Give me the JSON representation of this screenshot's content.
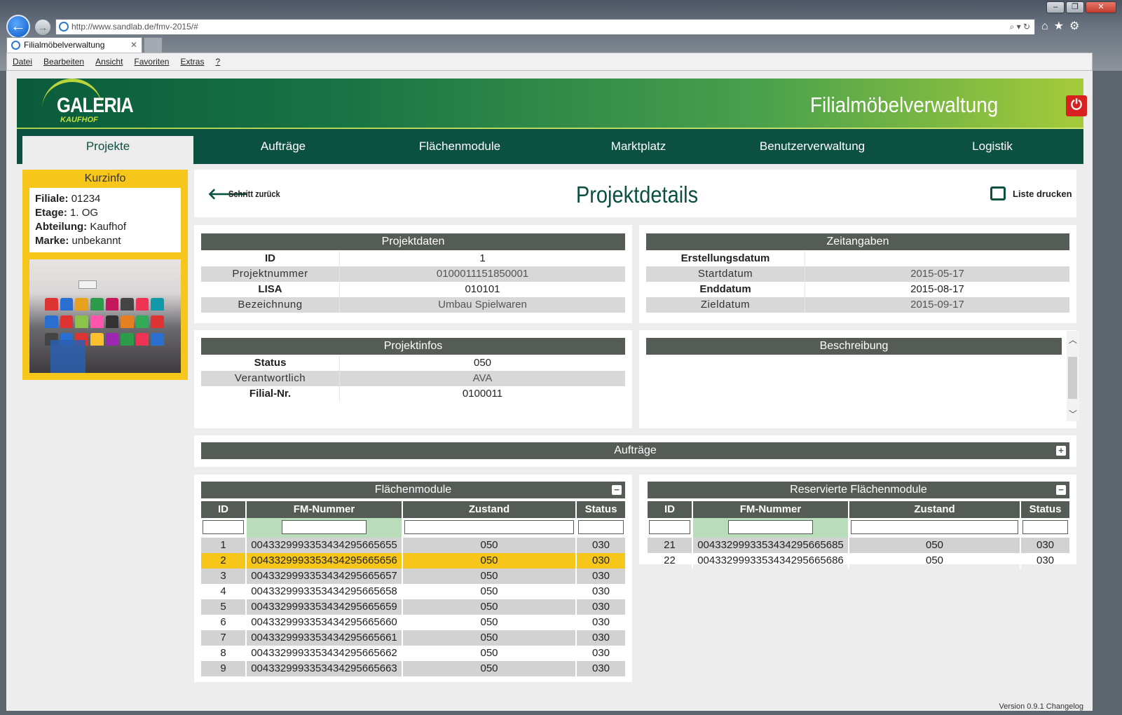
{
  "browser": {
    "url": "http://www.sandlab.de/fmv-2015/#",
    "tab_title": "Filialmöbelverwaltung",
    "menu": [
      "Datei",
      "Bearbeiten",
      "Ansicht",
      "Favoriten",
      "Extras",
      "?"
    ]
  },
  "header": {
    "logo_main": "GALERIA",
    "logo_sub": "KAUFHOF",
    "app_title": "Filialmöbelverwaltung"
  },
  "nav": [
    "Projekte",
    "Aufträge",
    "Flächenmodule",
    "Marktplatz",
    "Benutzerverwaltung",
    "Logistik"
  ],
  "kurzinfo": {
    "title": "Kurzinfo",
    "filiale_label": "Filiale:",
    "filiale": "01234",
    "etage_label": "Etage:",
    "etage": "1. OG",
    "abteilung_label": "Abteilung:",
    "abteilung": "Kaufhof",
    "marke_label": "Marke:",
    "marke": "unbekannt"
  },
  "toolbar": {
    "back_label": "Schritt zurück",
    "page_title": "Projektdetails",
    "print_label": "Liste drucken"
  },
  "projektdaten": {
    "title": "Projektdaten",
    "rows": [
      {
        "k": "ID",
        "v": "1"
      },
      {
        "k": "Projektnummer",
        "v": "0100011151850001"
      },
      {
        "k": "LISA",
        "v": "010101"
      },
      {
        "k": "Bezeichnung",
        "v": "Umbau Spielwaren"
      }
    ]
  },
  "zeitangaben": {
    "title": "Zeitangaben",
    "rows": [
      {
        "k": "Erstellungsdatum",
        "v": ""
      },
      {
        "k": "Startdatum",
        "v": "2015-05-17"
      },
      {
        "k": "Enddatum",
        "v": "2015-08-17"
      },
      {
        "k": "Zieldatum",
        "v": "2015-09-17"
      }
    ]
  },
  "projektinfos": {
    "title": "Projektinfos",
    "rows": [
      {
        "k": "Status",
        "v": "050"
      },
      {
        "k": "Verantwortlich",
        "v": "AVA"
      },
      {
        "k": "Filial-Nr.",
        "v": "0100011"
      }
    ]
  },
  "beschreibung": {
    "title": "Beschreibung"
  },
  "auftraege": {
    "title": "Aufträge"
  },
  "flaechenmodule": {
    "title": "Flächenmodule",
    "columns": [
      "ID",
      "FM-Nummer",
      "Zustand",
      "Status"
    ],
    "rows": [
      [
        "1",
        "004332999335343429566565­5",
        "050",
        "030"
      ],
      [
        "2",
        "0043329993353434295665656",
        "050",
        "030"
      ],
      [
        "3",
        "0043329993353434295665657",
        "050",
        "030"
      ],
      [
        "4",
        "0043329993353434295665658",
        "050",
        "030"
      ],
      [
        "5",
        "0043329993353434295665659",
        "050",
        "030"
      ],
      [
        "6",
        "0043329993353434295665660",
        "050",
        "030"
      ],
      [
        "7",
        "0043329993353434295665661",
        "050",
        "030"
      ],
      [
        "8",
        "0043329993353434295665662",
        "050",
        "030"
      ],
      [
        "9",
        "0043329993353434295665663",
        "050",
        "030"
      ]
    ],
    "selected_row": 2
  },
  "reserviert": {
    "title": "Reservierte Flächenmodule",
    "columns": [
      "ID",
      "FM-Nummer",
      "Zustand",
      "Status"
    ],
    "rows": [
      [
        "21",
        "0043329993353434295665685",
        "050",
        "030"
      ],
      [
        "22",
        "0043329993353434295665686",
        "050",
        "030"
      ]
    ]
  },
  "footer": {
    "version": "Version 0.9.1 Changelog"
  },
  "colors": {
    "brand_green": "#0b5040",
    "accent_yellow": "#f7c61a",
    "header_grey": "#555b55",
    "power_red": "#d72020"
  }
}
